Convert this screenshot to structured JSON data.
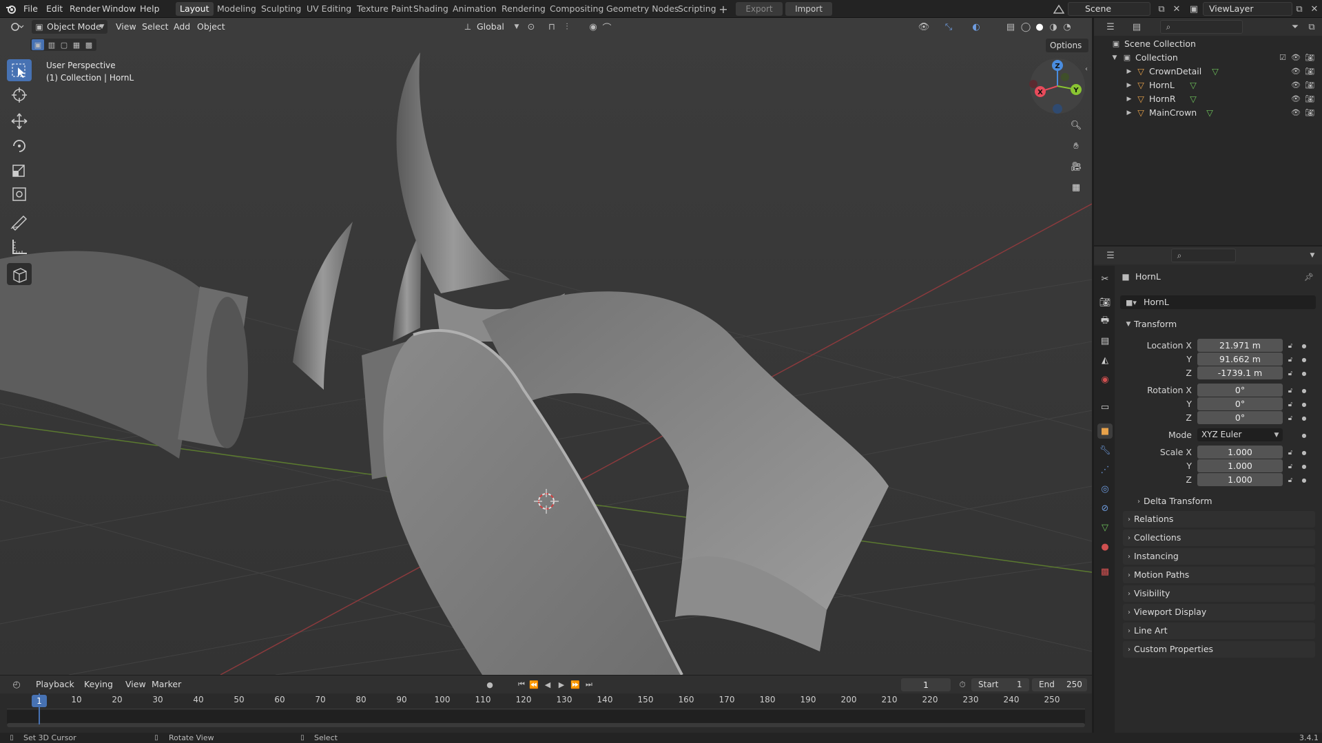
{
  "topbar": {
    "menus": [
      "File",
      "Edit",
      "Render",
      "Window",
      "Help"
    ],
    "workspaces": [
      "Layout",
      "Modeling",
      "Sculpting",
      "UV Editing",
      "Texture Paint",
      "Shading",
      "Animation",
      "Rendering",
      "Compositing",
      "Geometry Nodes",
      "Scripting"
    ],
    "active_workspace": "Layout",
    "export_label": "Export",
    "import_label": "Import",
    "scene_name": "Scene",
    "view_layer_name": "ViewLayer"
  },
  "viewport": {
    "mode": "Object Mode",
    "menus": [
      "View",
      "Select",
      "Add",
      "Object"
    ],
    "orientation": "Global",
    "options_label": "Options",
    "overlay_line1": "User Perspective",
    "overlay_line2": "(1) Collection | HornL",
    "gizmo_axes": {
      "x": "X",
      "y": "Y",
      "z": "Z"
    },
    "colors": {
      "x": "#e84b5b",
      "y": "#8ac532",
      "z": "#4a8de0",
      "active_tool": "#4772b3"
    }
  },
  "outliner": {
    "scene_collection": "Scene Collection",
    "collection": "Collection",
    "objects": [
      "CrownDetail",
      "HornL",
      "HornR",
      "MainCrown"
    ]
  },
  "properties": {
    "object_name": "HornL",
    "datablock_name": "HornL",
    "transform_label": "Transform",
    "location_label": "Location X",
    "location": {
      "x": "21.971 m",
      "y": "91.662 m",
      "z": "-1739.1 m"
    },
    "rotation_label": "Rotation X",
    "rotation": {
      "x": "0°",
      "y": "0°",
      "z": "0°"
    },
    "mode_label": "Mode",
    "mode_value": "XYZ Euler",
    "scale_label": "Scale X",
    "scale": {
      "x": "1.000",
      "y": "1.000",
      "z": "1.000"
    },
    "axis_y": "Y",
    "axis_z": "Z",
    "delta_transform": "Delta Transform",
    "panels": [
      "Relations",
      "Collections",
      "Instancing",
      "Motion Paths",
      "Visibility",
      "Viewport Display",
      "Line Art",
      "Custom Properties"
    ]
  },
  "timeline": {
    "menus": [
      "Playback",
      "Keying",
      "View",
      "Marker"
    ],
    "current_frame": "1",
    "start_label": "Start",
    "start": "1",
    "end_label": "End",
    "end": "250",
    "ticks": [
      "1",
      "10",
      "20",
      "30",
      "40",
      "50",
      "60",
      "70",
      "80",
      "90",
      "100",
      "110",
      "120",
      "130",
      "140",
      "150",
      "160",
      "170",
      "180",
      "190",
      "200",
      "210",
      "220",
      "230",
      "240",
      "250"
    ]
  },
  "statusbar": {
    "left": "Set 3D Cursor",
    "middle": "Rotate View",
    "right": "Select",
    "version": "3.4.1"
  }
}
